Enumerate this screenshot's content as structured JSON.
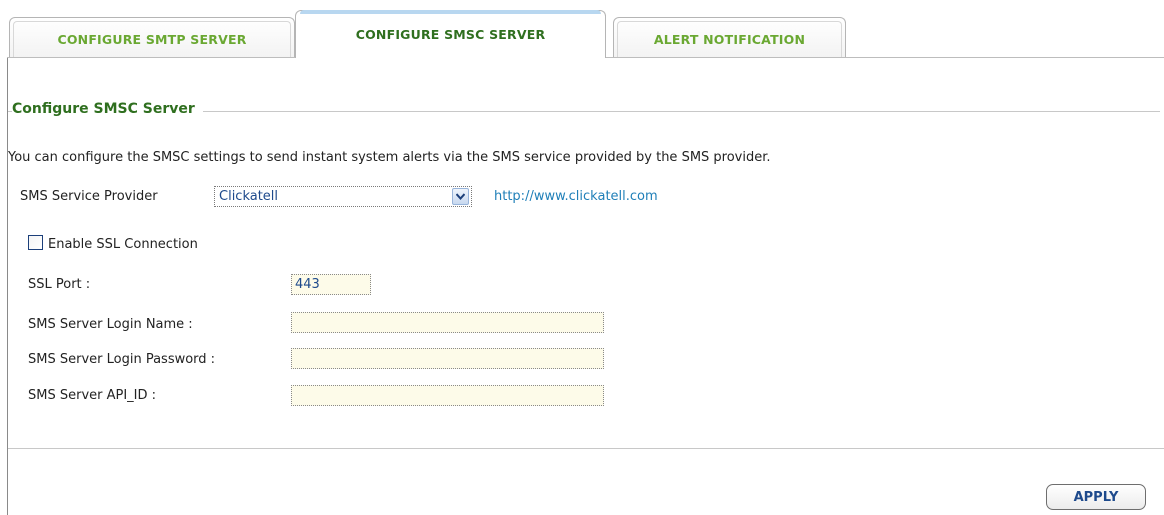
{
  "tabs": [
    {
      "label": "CONFIGURE SMTP SERVER",
      "active": false
    },
    {
      "label": "CONFIGURE SMSC SERVER",
      "active": true
    },
    {
      "label": "ALERT NOTIFICATION",
      "active": false
    }
  ],
  "section": {
    "title": "Configure SMSC Server",
    "description": "You can configure the SMSC settings to send instant system alerts via the SMS service provided by the SMS provider."
  },
  "provider": {
    "label": "SMS Service Provider",
    "selected": "Clickatell",
    "link": "http://www.clickatell.com"
  },
  "ssl": {
    "checkbox_label": "Enable SSL Connection",
    "checked": false,
    "port_label": "SSL Port :",
    "port_value": "443"
  },
  "fields": {
    "login_name_label": "SMS Server Login Name :",
    "login_name_value": "",
    "login_password_label": "SMS Server Login Password :",
    "login_password_value": "",
    "api_id_label": "SMS Server API_ID :",
    "api_id_value": ""
  },
  "actions": {
    "apply_label": "APPLY"
  },
  "colors": {
    "tab_text": "#6aa832",
    "active_tab_text": "#2f6f1f",
    "title": "#2f6f1f",
    "link": "#1f7fb8",
    "field_bg": "#fdfbe9",
    "button_text": "#1e4a8c"
  },
  "icons": {
    "select_arrow": "chevron-down-icon"
  }
}
